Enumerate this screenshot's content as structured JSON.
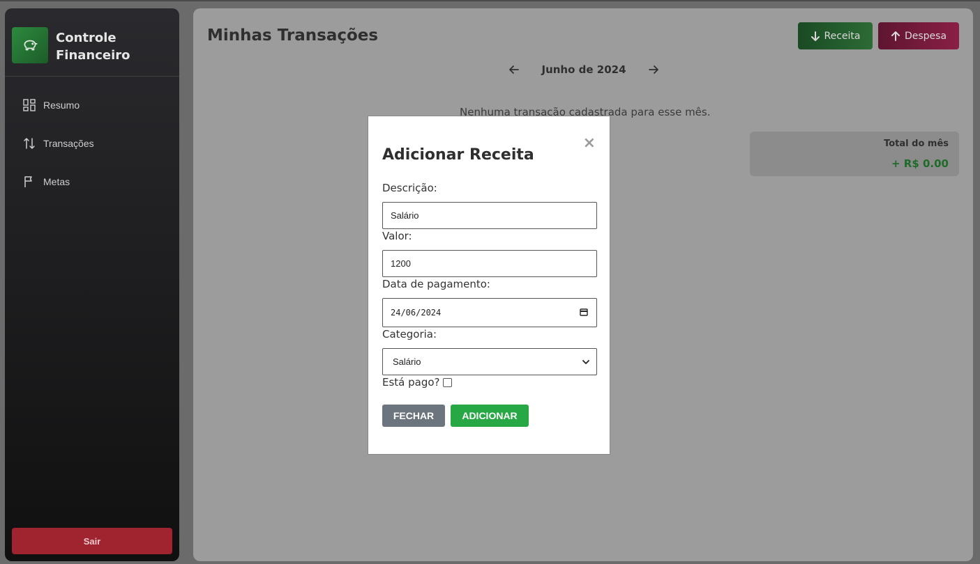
{
  "sidebar": {
    "brand_title": "Controle Financeiro",
    "items": [
      {
        "label": "Resumo",
        "icon": "dashboard-icon"
      },
      {
        "label": "Transações",
        "icon": "swap-vertical-icon"
      },
      {
        "label": "Metas",
        "icon": "flag-icon"
      }
    ],
    "logout_label": "Sair"
  },
  "main": {
    "title": "Minhas Transações",
    "receita_label": "Receita",
    "despesa_label": "Despesa",
    "month_label": "Junho de 2024",
    "empty_message": "Nenhuma transação cadastrada para esse mês.",
    "total_label": "Total do mês",
    "total_value": "+ R$ 0.00"
  },
  "modal": {
    "title": "Adicionar Receita",
    "close_symbol": "×",
    "descricao_label": "Descrição:",
    "descricao_value": "Salário",
    "valor_label": "Valor:",
    "valor_value": "1200",
    "data_label": "Data de pagamento:",
    "data_value": "24/06/2024",
    "categoria_label": "Categoria:",
    "categoria_value": "Salário",
    "pago_label": "Está pago?",
    "pago_checked": false,
    "fechar_label": "FECHAR",
    "adicionar_label": "ADICIONAR"
  },
  "colors": {
    "receita": "#2c6b35",
    "despesa": "#8a1f45",
    "logout": "#a02330",
    "adicionar": "#28a745",
    "fechar": "#6c757d",
    "total_positive": "#1f6b2a"
  }
}
